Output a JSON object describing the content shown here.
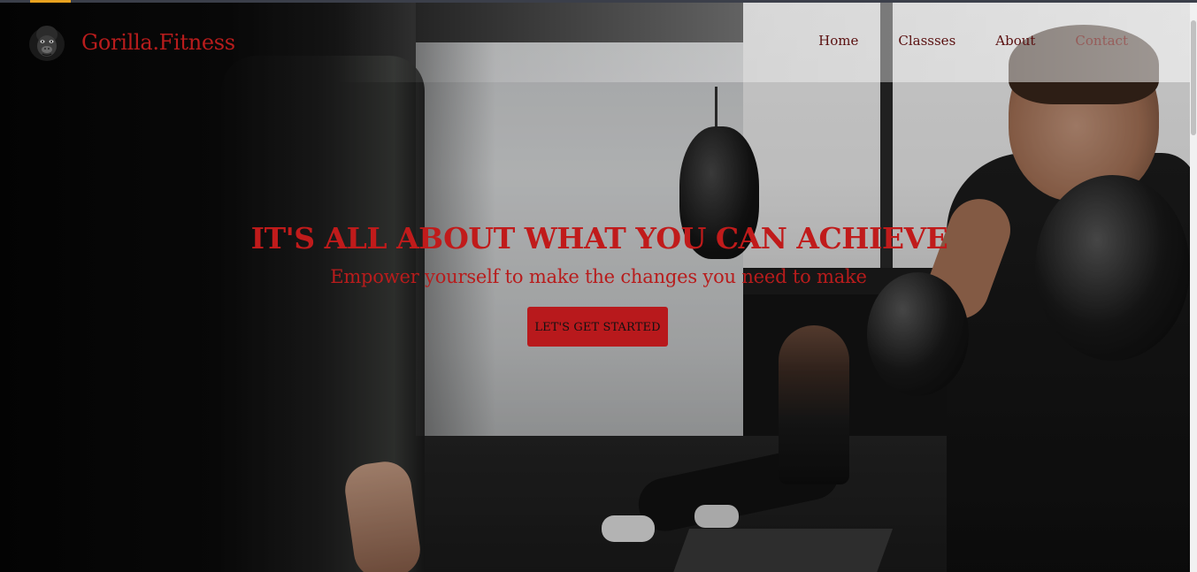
{
  "brand": {
    "name": "Gorilla.Fitness",
    "logo_icon": "gorilla-logo-icon"
  },
  "nav": {
    "items": [
      {
        "label": "Home"
      },
      {
        "label": "Classses"
      },
      {
        "label": "About"
      },
      {
        "label": "Contact"
      }
    ]
  },
  "hero": {
    "title": "IT'S ALL ABOUT WHAT YOU CAN ACHIEVE",
    "subtitle": "Empower yourself to make the changes you need to make",
    "cta_label": "LET'S GET STARTED"
  },
  "colors": {
    "accent": "#b81c1c",
    "nav_text": "#5a1010",
    "cta_background": "#b8191c"
  }
}
